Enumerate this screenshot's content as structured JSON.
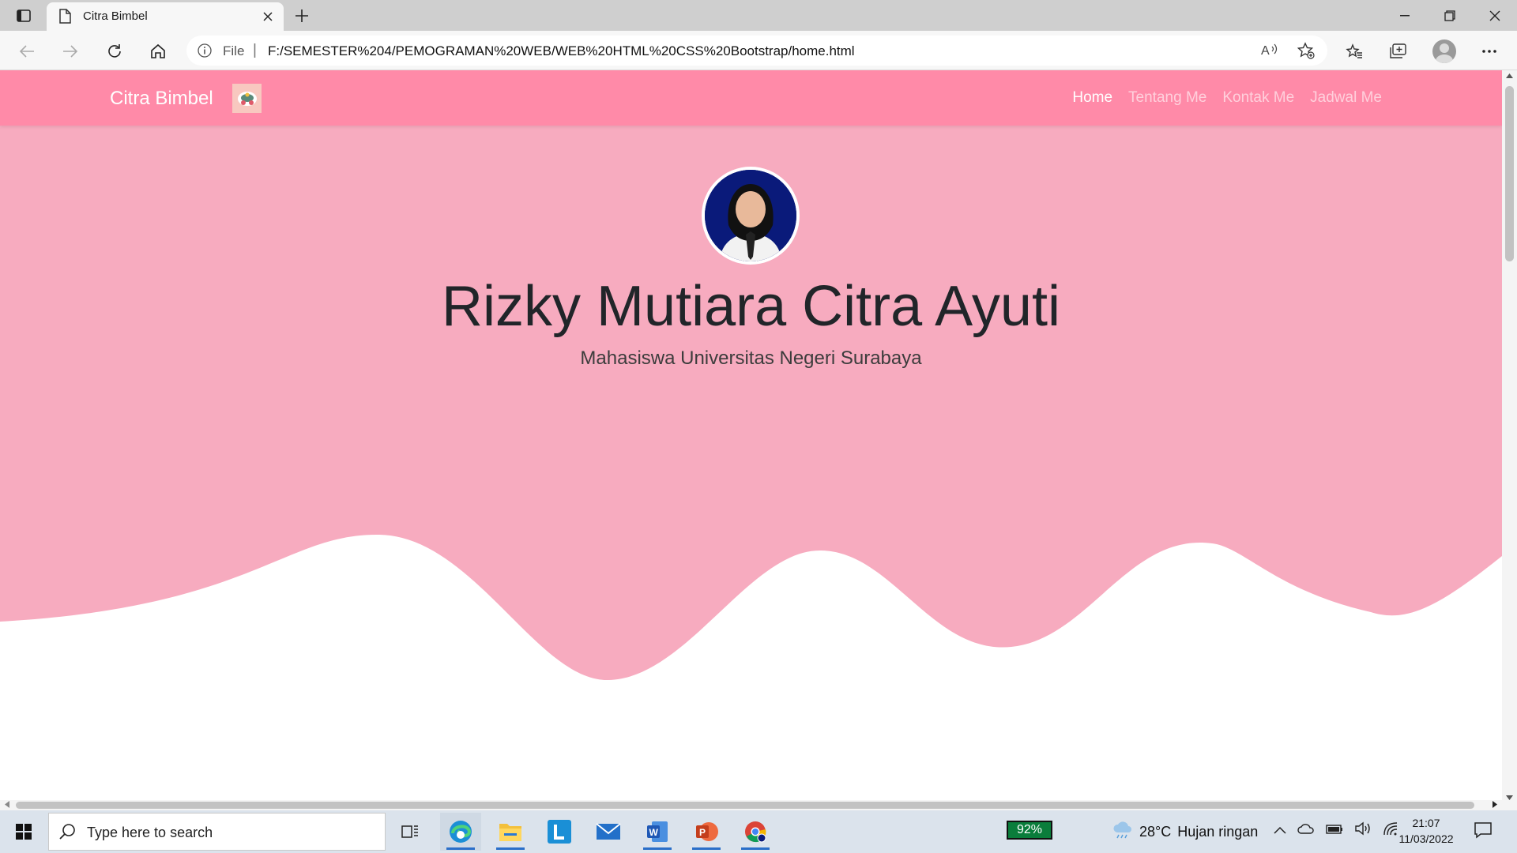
{
  "browser": {
    "tab_title": "Citra Bimbel",
    "address_scheme": "File",
    "address_url": "F:/SEMESTER%204/PEMOGRAMAN%20WEB/WEB%20HTML%20CSS%20Bootstrap/home.html"
  },
  "page": {
    "brand": "Citra Bimbel",
    "nav": [
      "Home",
      "Tentang Me",
      "Kontak Me",
      "Jadwal Me"
    ],
    "active_nav": "Home",
    "hero_title": "Rizky Mutiara Citra Ayuti",
    "hero_subtitle": "Mahasiswa Universitas Negeri Surabaya"
  },
  "colors": {
    "navbar": "#ff8aa8",
    "hero": "#f7abbf",
    "accent_blue": "#0a1a7a"
  },
  "taskbar": {
    "search_placeholder": "Type here to search",
    "battery_widget": "92%",
    "weather_temp": "28°C",
    "weather_desc": "Hujan ringan",
    "time": "21:07",
    "date": "11/03/2022",
    "apps": [
      "task-view-icon",
      "edge-icon",
      "file-explorer-icon",
      "l-app-icon",
      "mail-icon",
      "word-icon",
      "powerpoint-icon",
      "chrome-icon"
    ]
  }
}
